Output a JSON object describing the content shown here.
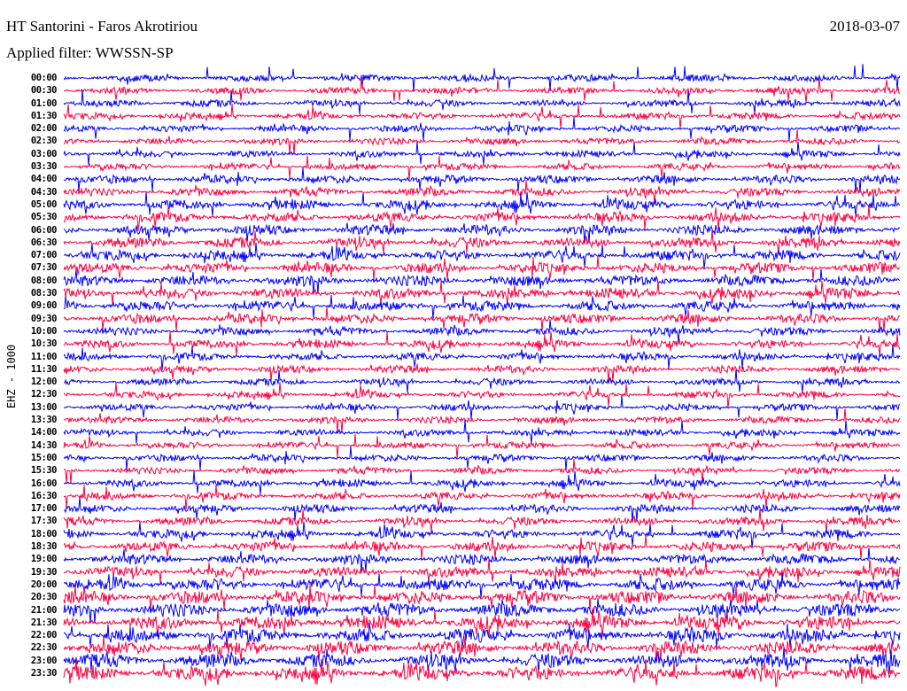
{
  "header": {
    "station": "HT Santorini - Faros Akrotiriou",
    "date": "2018-03-07",
    "filter": "Applied filter: WWSSN-SP"
  },
  "colors": {
    "even_rows": "#0000ff",
    "odd_rows": "#ff0040",
    "background": "#ffffff"
  },
  "chart_data": {
    "type": "line",
    "title": "HT Santorini - Faros Akrotiriou",
    "ylabel": "EHZ - 1000",
    "row_labels": [
      "00:00",
      "00:30",
      "01:00",
      "01:30",
      "02:00",
      "02:30",
      "03:00",
      "03:30",
      "04:00",
      "04:30",
      "05:00",
      "05:30",
      "06:00",
      "06:30",
      "07:00",
      "07:30",
      "08:00",
      "08:30",
      "09:00",
      "09:30",
      "10:00",
      "10:30",
      "11:00",
      "11:30",
      "12:00",
      "12:30",
      "13:00",
      "13:30",
      "14:00",
      "14:30",
      "15:00",
      "15:30",
      "16:00",
      "16:30",
      "17:00",
      "17:30",
      "18:00",
      "18:30",
      "19:00",
      "19:30",
      "20:00",
      "20:30",
      "21:00",
      "21:30",
      "22:00",
      "22:30",
      "23:00",
      "23:30"
    ],
    "row_minutes": 30,
    "relative_noise_level": [
      0.5,
      0.5,
      0.5,
      0.5,
      0.5,
      0.5,
      0.5,
      0.5,
      0.6,
      0.6,
      0.7,
      0.7,
      0.75,
      0.75,
      0.75,
      0.75,
      0.8,
      0.8,
      0.75,
      0.7,
      0.6,
      0.6,
      0.55,
      0.55,
      0.5,
      0.5,
      0.5,
      0.5,
      0.5,
      0.5,
      0.5,
      0.5,
      0.55,
      0.55,
      0.6,
      0.6,
      0.65,
      0.7,
      0.75,
      0.8,
      0.9,
      0.95,
      1.0,
      1.0,
      1.0,
      1.0,
      1.0,
      1.0
    ]
  }
}
